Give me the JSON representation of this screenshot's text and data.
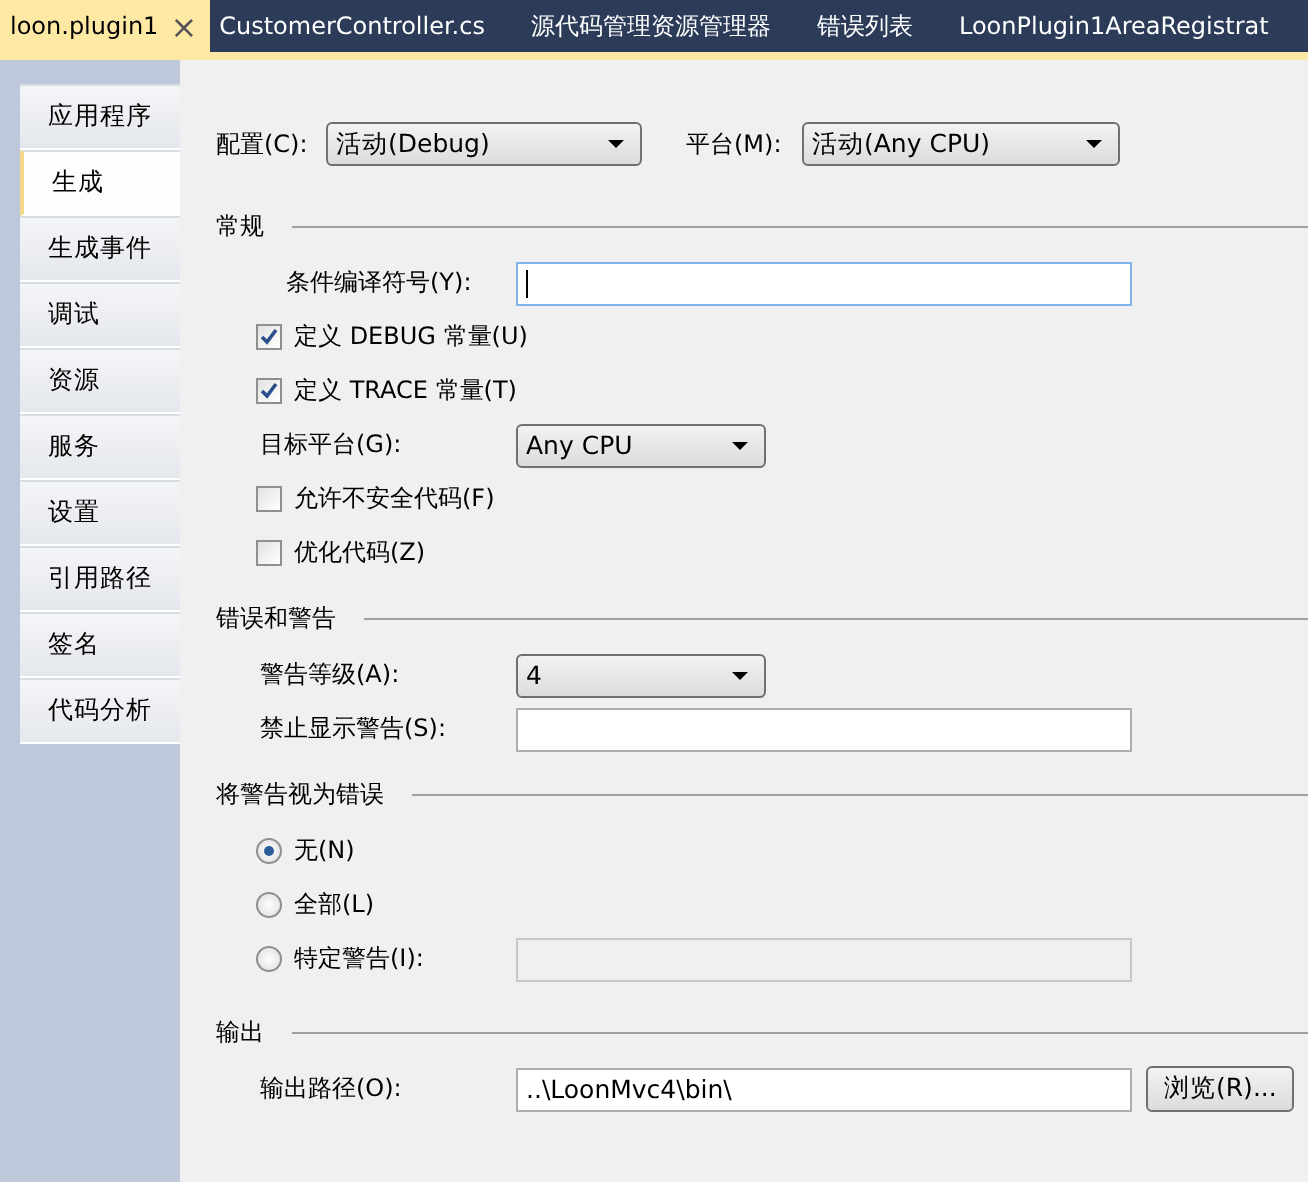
{
  "doc_tabs": [
    {
      "label": "loon.plugin1",
      "selected": true,
      "close": "×"
    },
    {
      "label": "CustomerController.cs",
      "selected": false
    },
    {
      "label": "源代码管理资源管理器",
      "selected": false
    },
    {
      "label": "错误列表",
      "selected": false
    },
    {
      "label": "LoonPlugin1AreaRegistrat",
      "selected": false
    }
  ],
  "side_tabs": [
    {
      "label": "应用程序",
      "selected": false
    },
    {
      "label": "生成",
      "selected": true
    },
    {
      "label": "生成事件",
      "selected": false
    },
    {
      "label": "调试",
      "selected": false
    },
    {
      "label": "资源",
      "selected": false
    },
    {
      "label": "服务",
      "selected": false
    },
    {
      "label": "设置",
      "selected": false
    },
    {
      "label": "引用路径",
      "selected": false
    },
    {
      "label": "签名",
      "selected": false
    },
    {
      "label": "代码分析",
      "selected": false
    }
  ],
  "config": {
    "label": "配置(C):",
    "value": "活动(Debug)"
  },
  "platform": {
    "label": "平台(M):",
    "value": "活动(Any CPU)"
  },
  "sections": [
    {
      "title": "常规",
      "rows": [
        {
          "kind": "field",
          "label": "条件编译符号(Y):",
          "focused": true
        },
        {
          "kind": "check",
          "label": "定义 DEBUG 常量(U)",
          "checked": true
        },
        {
          "kind": "check",
          "label": "定义 TRACE 常量(T)",
          "checked": true
        },
        {
          "kind": "select",
          "label": "目标平台(G):",
          "value": "Any CPU"
        },
        {
          "kind": "check",
          "label": "允许不安全代码(F)",
          "checked": false
        },
        {
          "kind": "check",
          "label": "优化代码(Z)",
          "checked": false
        }
      ]
    },
    {
      "title": "错误和警告",
      "rows": [
        {
          "kind": "select",
          "label": "警告等级(A):",
          "value": "4"
        },
        {
          "kind": "field",
          "label": "禁止显示警告(S):",
          "focused": false
        }
      ]
    },
    {
      "title": "将警告视为错误",
      "rows": [
        {
          "kind": "radio",
          "label": "无(N)",
          "selected": true
        },
        {
          "kind": "radio",
          "label": "全部(L)",
          "selected": false
        },
        {
          "kind": "radio",
          "label": "特定警告(I):",
          "selected": false,
          "field_disabled": true
        }
      ]
    },
    {
      "title": "输出",
      "rows": [
        {
          "kind": "field",
          "label": "输出路径(O):",
          "value": "..\\LoonMvc4\\bin\\",
          "focused": false,
          "button": "浏览(R)..."
        }
      ]
    }
  ]
}
